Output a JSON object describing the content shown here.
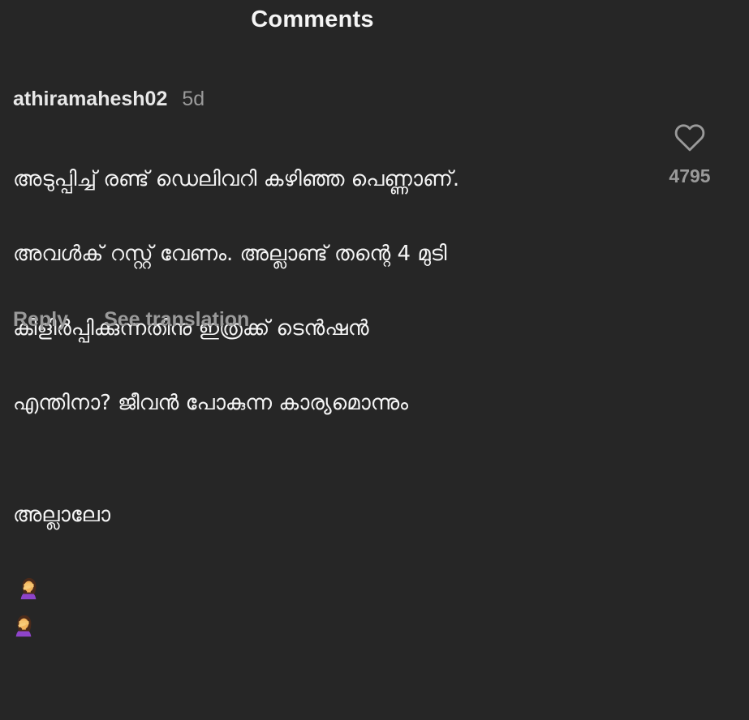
{
  "header": {
    "title": "Comments"
  },
  "comment": {
    "username": "athiramahesh02",
    "timestamp": "5d",
    "lines": [
      "അടുപ്പിച്ച് രണ്ട് ഡെലിവറി കഴിഞ്ഞ പെണ്ണാണ്.",
      "അവൾക് റസ്റ്റ് വേണം. അല്ലാണ്ട് തന്റെ 4 മുടി",
      "കിളിർപ്പിക്കുന്നതിനു ഇത്രക്ക് ടെൻഷൻ",
      "എന്തിനാ? ജീവൻ പോകുന്ന കാര്യമൊന്നും",
      "അല്ലാലോ"
    ],
    "emoji": "🤦‍♀️🤦‍♀️",
    "like_count": "4795",
    "heart_icon": "heart-outline-icon",
    "actions": {
      "reply": "Reply",
      "see_translation": "See translation"
    }
  },
  "colors": {
    "background": "#262626",
    "primary_text": "#f5f5f5",
    "secondary_text": "#9a9a9a"
  }
}
